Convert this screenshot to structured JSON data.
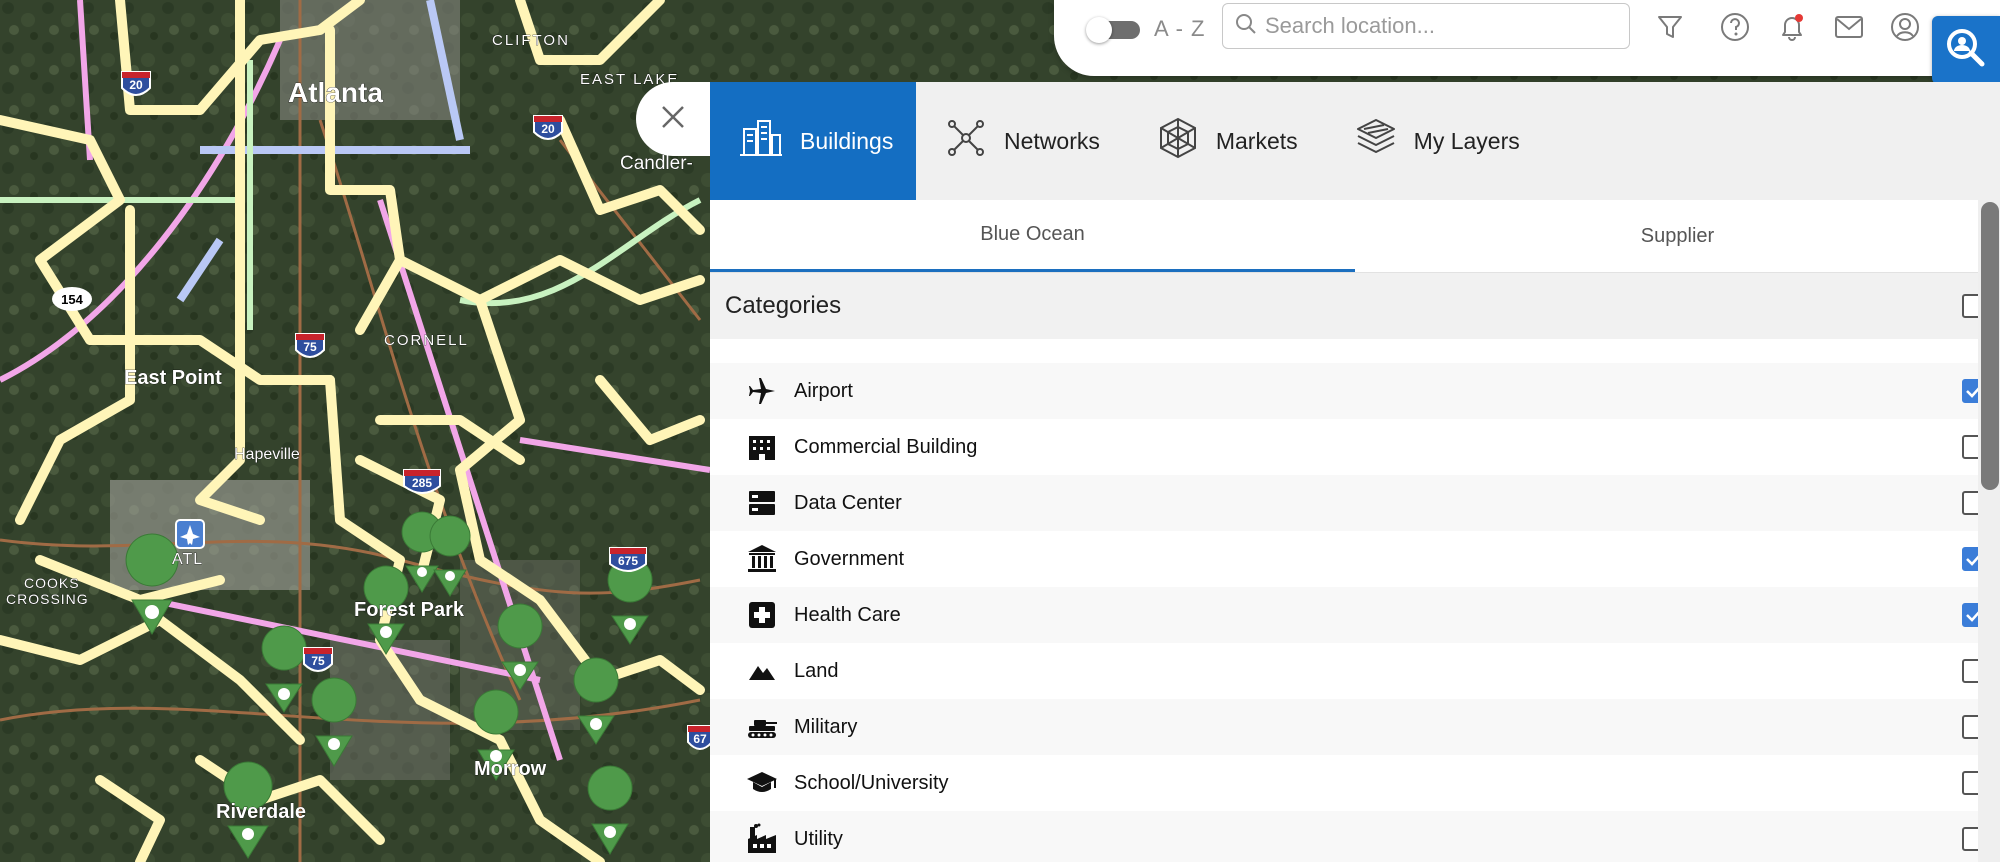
{
  "map": {
    "labels": {
      "atlanta": "Atlanta",
      "clifton": "CLIFTON",
      "east_lake": "EAST LAKE",
      "candler": "Candler-",
      "east_point": "East Point",
      "cornell": "CORNELL",
      "hapeville": "Hapeville",
      "atl": "ATL",
      "cooks_crossing_1": "COOKS",
      "cooks_crossing_2": "CROSSING",
      "forest_park": "Forest Park",
      "morrow": "Morrow",
      "riverdale": "Riverdale"
    },
    "shields": {
      "i20_a": "20",
      "i20_b": "20",
      "i75_a": "75",
      "i75_b": "75",
      "i285": "285",
      "i675": "675",
      "i67": "67",
      "r154": "154"
    }
  },
  "toolbar": {
    "az_label": "A - Z",
    "search_placeholder": "Search location...",
    "icons": [
      "filter-icon",
      "help-icon",
      "bell-icon",
      "mail-icon",
      "user-icon",
      "geo-search-icon"
    ]
  },
  "panel": {
    "tabs": [
      {
        "label": "Buildings",
        "icon": "buildings-icon",
        "active": true
      },
      {
        "label": "Networks",
        "icon": "network-icon",
        "active": false
      },
      {
        "label": "Markets",
        "icon": "markets-icon",
        "active": false
      },
      {
        "label": "My Layers",
        "icon": "layers-icon",
        "active": false
      }
    ],
    "subtabs": [
      {
        "label": "Blue Ocean",
        "active": true
      },
      {
        "label": "Supplier",
        "active": false
      }
    ],
    "categories_title": "Categories",
    "categories": [
      {
        "label": "Airport",
        "icon": "airplane-icon",
        "checked": true
      },
      {
        "label": "Commercial Building",
        "icon": "office-building-icon",
        "checked": false
      },
      {
        "label": "Data Center",
        "icon": "server-icon",
        "checked": false
      },
      {
        "label": "Government",
        "icon": "government-icon",
        "checked": true
      },
      {
        "label": "Health Care",
        "icon": "medical-cross-icon",
        "checked": true
      },
      {
        "label": "Land",
        "icon": "mountains-icon",
        "checked": false
      },
      {
        "label": "Military",
        "icon": "tank-icon",
        "checked": false
      },
      {
        "label": "School/University",
        "icon": "graduation-cap-icon",
        "checked": false
      },
      {
        "label": "Utility",
        "icon": "factory-icon",
        "checked": false
      }
    ]
  },
  "colors": {
    "accent": "#146ec2",
    "checkbox": "#3b7dd8",
    "marker_green": "#4f9a4a",
    "road_yellow": "#fff5b8"
  }
}
